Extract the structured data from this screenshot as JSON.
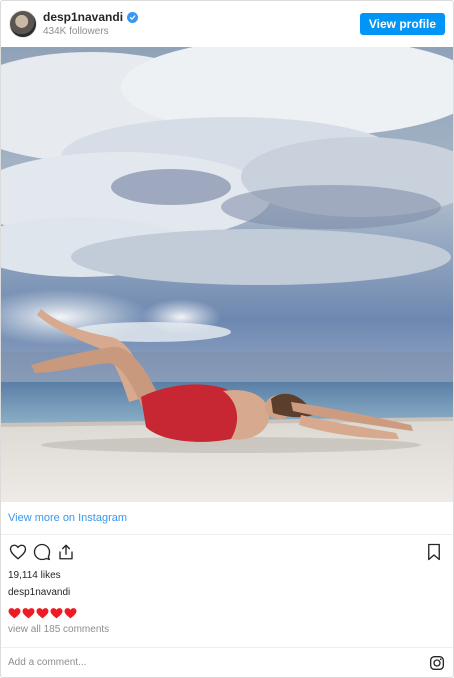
{
  "header": {
    "username": "desp1navandi",
    "followers": "434K followers",
    "view_profile_label": "View profile",
    "verified_icon": "verified-badge-icon"
  },
  "post": {
    "view_more_label": "View more on Instagram",
    "likes": "19,114 likes",
    "caption_user": "desp1navandi",
    "caption_emoji": "red-heart-icon x5",
    "comments_label": "view all 185 comments"
  },
  "comment_bar": {
    "placeholder": "Add a comment...",
    "logo_icon": "instagram-icon"
  },
  "colors": {
    "accent": "#0095f6",
    "link": "#3897f0",
    "muted": "#8e8e8e",
    "heart": "#ed1c24"
  }
}
